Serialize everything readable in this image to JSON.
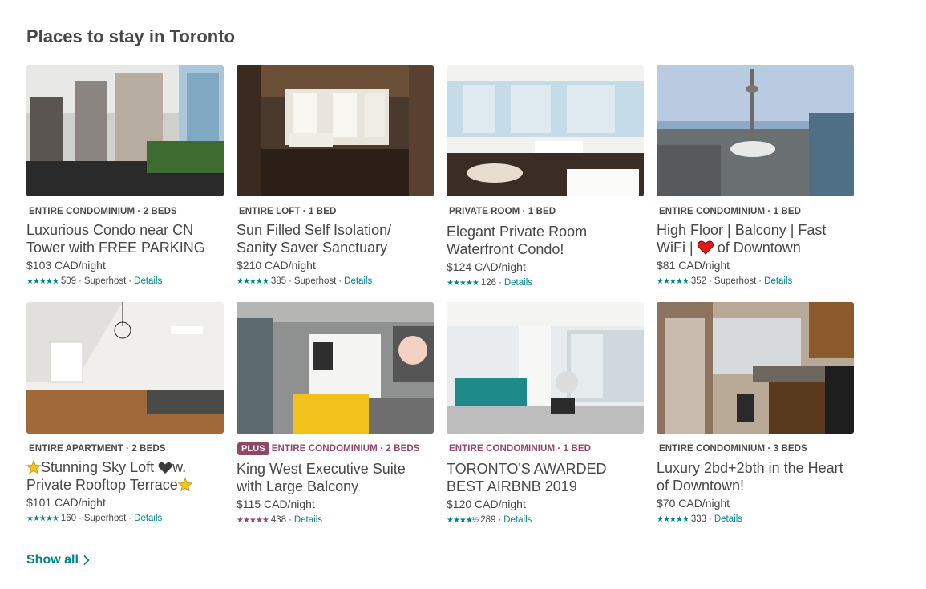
{
  "section": {
    "title": "Places to stay in Toronto"
  },
  "listings": [
    {
      "kind": "ENTIRE CONDOMINIUM · 2 BEDS",
      "title": "Luxurious Condo near CN Tower with FREE PARKING",
      "price": "$103 CAD/night",
      "rating_count": "509",
      "superhost": "Superhost",
      "details": "Details"
    },
    {
      "kind": "ENTIRE LOFT · 1 BED",
      "title": "Sun Filled Self Isolation/ Sanity Saver Sanctuary",
      "price": "$210 CAD/night",
      "rating_count": "385",
      "superhost": "Superhost",
      "details": "Details"
    },
    {
      "kind": "PRIVATE ROOM · 1 BED",
      "title": "Elegant Private Room Waterfront Condo!",
      "price": "$124 CAD/night",
      "rating_count": "126",
      "details": "Details"
    },
    {
      "kind": "ENTIRE CONDOMINIUM · 1 BED",
      "title_line1": "High Floor | Balcony | Fast",
      "title_line2a": "WiFi |",
      "title_line2b": "of Downtown",
      "price": "$81 CAD/night",
      "rating_count": "352",
      "superhost": "Superhost",
      "details": "Details"
    },
    {
      "kind": "ENTIRE APARTMENT · 2 BEDS",
      "title_line1": "Stunning Sky Loft",
      "title_line1b": "w.",
      "title_line2": "Private Rooftop Terrace",
      "price": "$101 CAD/night",
      "rating_count": "160",
      "superhost": "Superhost",
      "details": "Details"
    },
    {
      "plus": "PLUS",
      "kind": "ENTIRE CONDOMINIUM · 2 BEDS",
      "title": "King West Executive Suite with Large Balcony",
      "price": "$115 CAD/night",
      "rating_count": "438",
      "details": "Details"
    },
    {
      "kind": "ENTIRE CONDOMINIUM · 1 BED",
      "title": "TORONTO'S AWARDED BEST AIRBNB 2019",
      "price": "$120 CAD/night",
      "rating_count": "289",
      "details": "Details"
    },
    {
      "kind": "ENTIRE CONDOMINIUM · 3 BEDS",
      "title": "Luxury 2bd+2bth in the Heart of Downtown!",
      "price": "$70 CAD/night",
      "rating_count": "333",
      "details": "Details"
    }
  ],
  "star_glyphs": {
    "full": "★★★★★",
    "four_half": "★★★★½"
  },
  "footer": {
    "show_all": "Show all"
  },
  "colors": {
    "teal": "#008489",
    "plum": "#914669",
    "text": "#484848"
  }
}
